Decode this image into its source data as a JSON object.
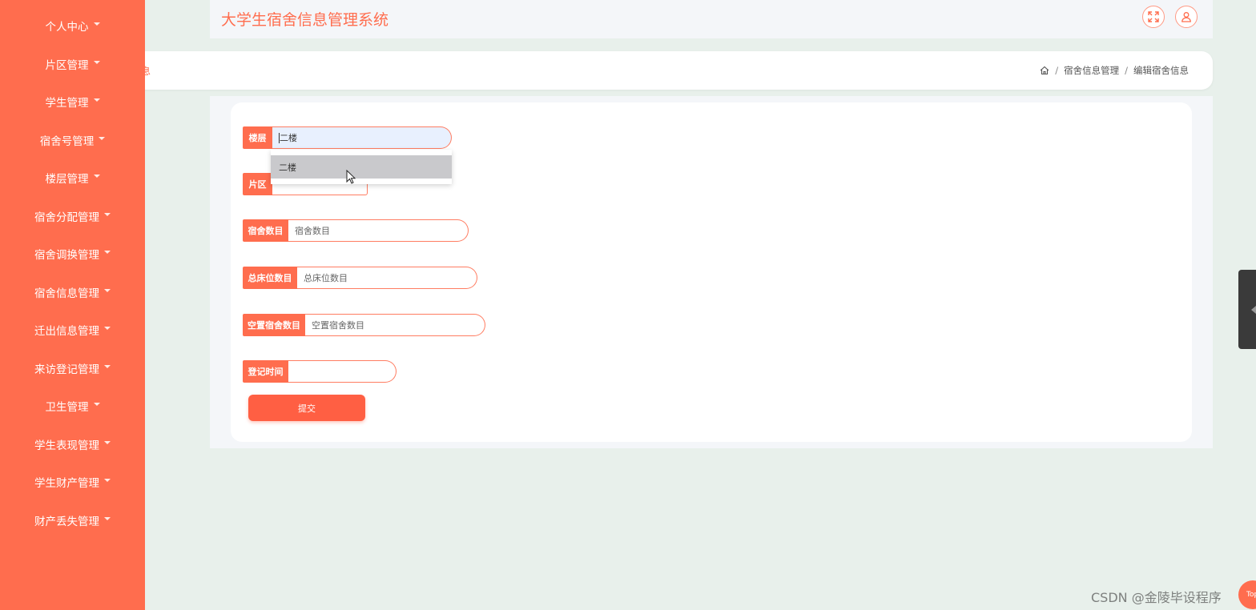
{
  "sidebar": {
    "items": [
      {
        "label": "个人中心"
      },
      {
        "label": "片区管理"
      },
      {
        "label": "学生管理"
      },
      {
        "label": "宿舍号管理"
      },
      {
        "label": "楼层管理"
      },
      {
        "label": "宿舍分配管理"
      },
      {
        "label": "宿舍调换管理"
      },
      {
        "label": "宿舍信息管理"
      },
      {
        "label": "迁出信息管理"
      },
      {
        "label": "来访登记管理"
      },
      {
        "label": "卫生管理"
      },
      {
        "label": "学生表现管理"
      },
      {
        "label": "学生财产管理"
      },
      {
        "label": "财产丢失管理"
      }
    ]
  },
  "header": {
    "title": "大学生宿舍信息管理系统",
    "fullscreen_icon": "expand-icon",
    "user_icon": "user-icon"
  },
  "breadcrumb_bar": {
    "cut_text": "息",
    "home_icon": "home-icon",
    "items": [
      "宿舍信息管理",
      "编辑宿舍信息"
    ],
    "separator": "/"
  },
  "form": {
    "floor": {
      "label": "楼层",
      "value": "二楼",
      "options": [
        "二楼"
      ]
    },
    "zone": {
      "label": "片区",
      "value": ""
    },
    "dorm_count": {
      "label": "宿舍数目",
      "placeholder": "宿舍数目"
    },
    "total_beds": {
      "label": "总床位数目",
      "placeholder": "总床位数目"
    },
    "empty_dorms": {
      "label": "空置宿舍数目",
      "placeholder": "空置宿舍数目"
    },
    "register_time": {
      "label": "登记时间",
      "value": ""
    },
    "submit_label": "提交"
  },
  "top_button_label": "Top",
  "watermark": "CSDN @金陵毕设程序",
  "colors": {
    "accent": "#ff6d4e",
    "background": "#e8f0eb"
  }
}
